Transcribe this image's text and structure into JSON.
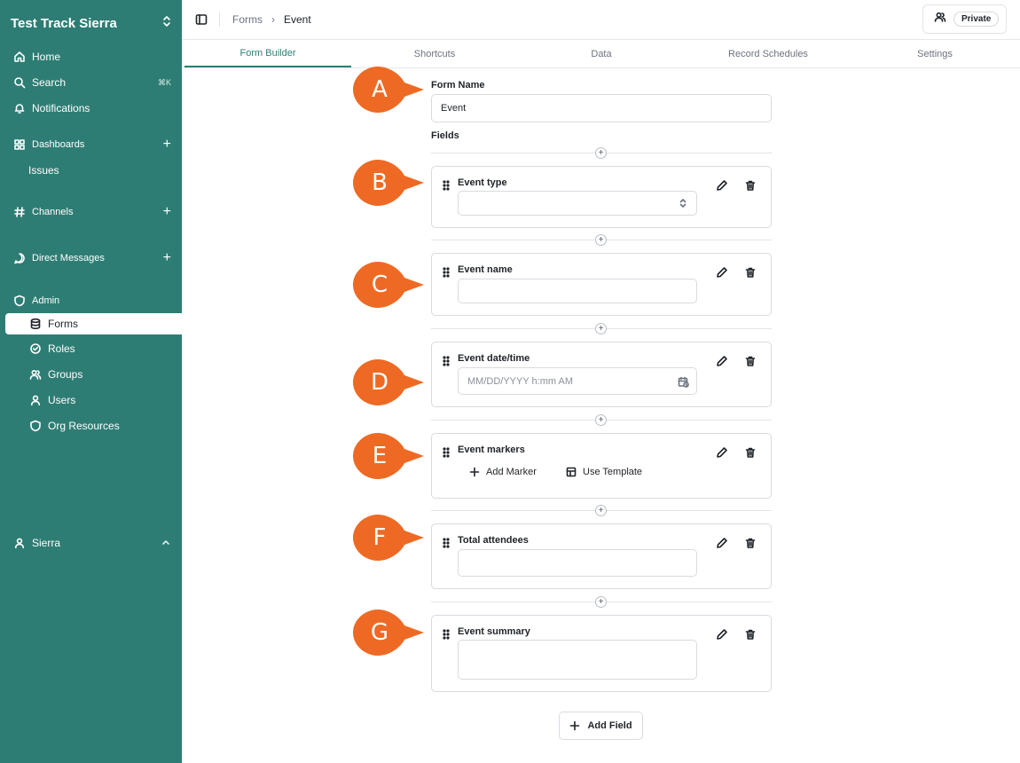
{
  "sidebar": {
    "workspace": "Test Track Sierra",
    "home": "Home",
    "search": "Search",
    "search_shortcut": "⌘K",
    "notifications": "Notifications",
    "dashboards": "Dashboards",
    "issues": "Issues",
    "channels": "Channels",
    "direct_messages": "Direct Messages",
    "admin": "Admin",
    "forms": "Forms",
    "roles": "Roles",
    "groups": "Groups",
    "users": "Users",
    "org_resources": "Org Resources",
    "user": "Sierra"
  },
  "header": {
    "breadcrumb_root": "Forms",
    "breadcrumb_current": "Event",
    "privacy_label": "Private"
  },
  "tabs": [
    "Form Builder",
    "Shortcuts",
    "Data",
    "Record Schedules",
    "Settings"
  ],
  "form": {
    "name_label": "Form Name",
    "name_value": "Event",
    "fields_label": "Fields",
    "fields": [
      {
        "title": "Event type",
        "callout": "B"
      },
      {
        "title": "Event name",
        "callout": "C"
      },
      {
        "title": "Event date/time",
        "callout": "D",
        "placeholder": "MM/DD/YYYY h:mm AM"
      },
      {
        "title": "Event markers",
        "callout": "E",
        "add_marker": "Add Marker",
        "use_template": "Use Template"
      },
      {
        "title": "Total attendees",
        "callout": "F"
      },
      {
        "title": "Event summary",
        "callout": "G"
      }
    ],
    "add_field_label": "Add Field",
    "name_callout": "A"
  },
  "colors": {
    "sidebar_bg": "#2e7d74",
    "accent": "#2e7d74",
    "callout": "#ee6a24"
  }
}
